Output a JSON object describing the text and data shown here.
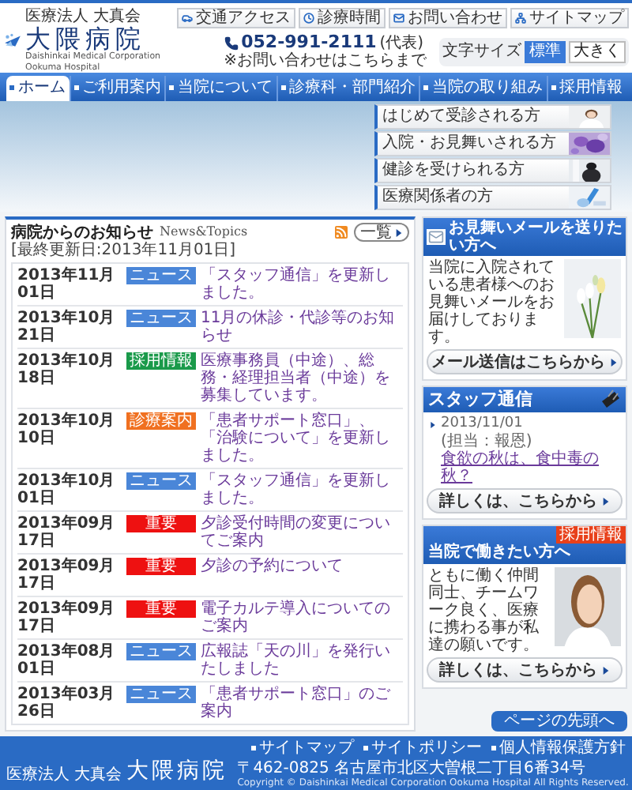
{
  "header": {
    "org": "医療法人 大真会",
    "name": "大隈病院",
    "subtitle": "Daishinkai Medical Corporation  Ookuma Hospital",
    "utility_links": [
      "交通アクセス",
      "診療時間",
      "お問い合わせ",
      "サイトマップ"
    ],
    "phone": {
      "number": "052-991-2111",
      "note": "(代表)",
      "caption": "※お問い合わせはこちらまで"
    },
    "font_size": {
      "label": "文字サイズ",
      "options": [
        {
          "label": "標準",
          "selected": true
        },
        {
          "label": "大きく",
          "selected": false
        }
      ]
    }
  },
  "nav": [
    {
      "label": "ホーム",
      "selected": true
    },
    {
      "label": "ご利用案内",
      "selected": false
    },
    {
      "label": "当院について",
      "selected": false
    },
    {
      "label": "診療科・部門紹介",
      "selected": false
    },
    {
      "label": "当院の取り組み",
      "selected": false
    },
    {
      "label": "採用情報",
      "selected": false
    }
  ],
  "audience_menu": [
    "はじめて受診される方",
    "入院・お見舞いされる方",
    "健診を受けられる方",
    "医療関係者の方"
  ],
  "news": {
    "title": "病院からのお知らせ",
    "subtitle": "News&Topics",
    "updated": "[最終更新日:2013年11月01日]",
    "list_button": "一覧",
    "items": [
      {
        "date": "2013年11月01日",
        "category": "ニュース",
        "color": "#4a86d8",
        "title": "「スタッフ通信」を更新しました。"
      },
      {
        "date": "2013年10月21日",
        "category": "ニュース",
        "color": "#4a86d8",
        "title": "11月の休診・代診等のお知らせ"
      },
      {
        "date": "2013年10月18日",
        "category": "採用情報",
        "color": "#1a9a4a",
        "title": "医療事務員（中途）、総務・経理担当者（中途）を募集しています。"
      },
      {
        "date": "2013年10月10日",
        "category": "診療案内",
        "color": "#f07020",
        "title": "「患者サポート窓口」、「治験について」を更新しました。"
      },
      {
        "date": "2013年10月01日",
        "category": "ニュース",
        "color": "#4a86d8",
        "title": "「スタッフ通信」を更新しました。"
      },
      {
        "date": "2013年09月17日",
        "category": "重要",
        "color": "#ee1111",
        "title": "夕診受付時間の変更についてご案内"
      },
      {
        "date": "2013年09月17日",
        "category": "重要",
        "color": "#ee1111",
        "title": "夕診の予約について"
      },
      {
        "date": "2013年09月17日",
        "category": "重要",
        "color": "#ee1111",
        "title": "電子カルテ導入についてのご案内"
      },
      {
        "date": "2013年08月01日",
        "category": "ニュース",
        "color": "#4a86d8",
        "title": "広報誌「天の川」を発行いたしました"
      },
      {
        "date": "2013年03月26日",
        "category": "ニュース",
        "color": "#4a86d8",
        "title": "「患者サポート窓口」のご案内"
      }
    ]
  },
  "sidebar": {
    "mail": {
      "title": "お見舞いメールを送りたい方へ",
      "body": "当院に入院されている患者様へのお見舞いメールをお届けしております。",
      "button": "メール送信はこちらから"
    },
    "staff": {
      "title": "スタッフ通信",
      "date": "2013/11/01",
      "author": "(担当：報恩)",
      "link": "食欲の秋は、食中毒の秋？",
      "button": "詳しくは、こちらから"
    },
    "recruit": {
      "title": "当院で働きたい方へ",
      "ribbon": "採用情報",
      "body": "ともに働く仲間同士、チームワーク良く、医療に携わる事が私達の願いです。",
      "button": "詳しくは、こちらから"
    }
  },
  "page_top": "ページの先頭へ",
  "footer": {
    "links": [
      "サイトマップ",
      "サイトポリシー",
      "個人情報保護方針"
    ],
    "org": "医療法人 大真会",
    "name": "大隈病院",
    "address": "〒462-0825 名古屋市北区大曽根二丁目6番34号",
    "copyright": "Copyright © Daishinkai Medical Corporation Ookuma Hospital All Rights Reserved."
  }
}
